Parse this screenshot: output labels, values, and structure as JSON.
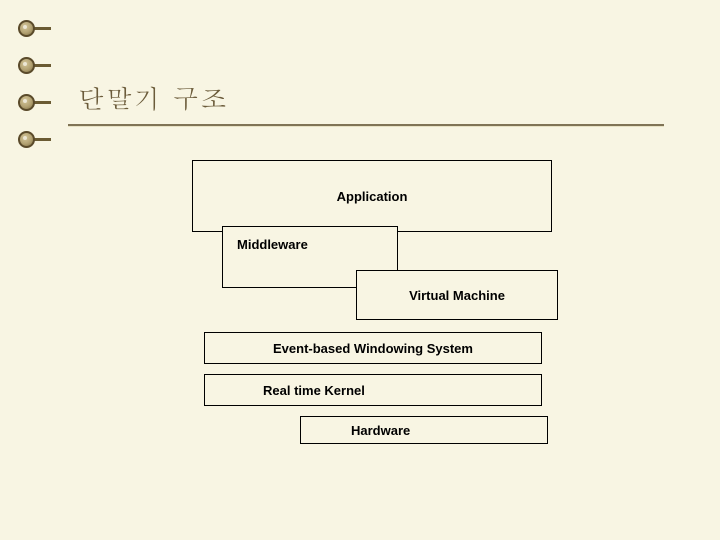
{
  "title": "단말기 구조",
  "diagram": {
    "application": "Application",
    "middleware": "Middleware",
    "virtual_machine": "Virtual Machine",
    "event_windowing": "Event-based Windowing System",
    "real_time_kernel": "Real time Kernel",
    "hardware": "Hardware"
  }
}
